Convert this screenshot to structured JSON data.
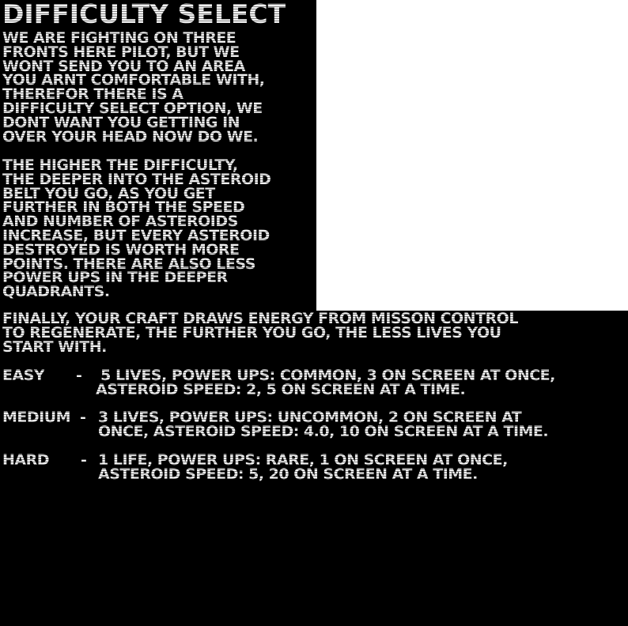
{
  "screen": {
    "title": "DIFFICULTY SELECT",
    "intro": "WE ARE FIGHTING ON THREE\nFRONTS HERE PILOT, BUT WE\nWONT SEND YOU TO AN AREA\nYOU ARNT COMFORTABLE WITH,\nTHEREFOR THERE IS A\nDIFFICULTY SELECT OPTION, WE\nDONT WANT YOU GETTING IN\nOVER YOUR HEAD NOW DO WE.",
    "explanation": "THE HIGHER THE DIFFICULTY,\nTHE DEEPER INTO THE ASTEROID\nBELT YOU GO, AS YOU GET\nFURTHER IN BOTH THE SPEED\nAND NUMBER OF ASTEROIDS\nINCREASE, BUT EVERY ASTEROID\nDESTROYED IS WORTH MORE\nPOINTS. THERE ARE ALSO LESS\nPOWER UPS IN THE DEEPER\nQUADRANTS.",
    "finally": "FINALLY, YOUR CRAFT DRAWS ENERGY FROM MISSON CONTROL\nTO REGENERATE, THE FURTHER YOU GO, THE LESS LIVES YOU\nSTART WITH."
  },
  "difficulties": [
    {
      "name": "EASY",
      "dash": "-",
      "description": " 5 LIVES, POWER UPS: COMMON, 3 ON SCREEN AT ONCE,\nASTEROID SPEED: 2, 5 ON SCREEN AT A TIME."
    },
    {
      "name": "MEDIUM",
      "dash": "-",
      "description": "3 LIVES, POWER UPS: UNCOMMON, 2 ON SCREEN AT\nONCE, ASTEROID SPEED: 4.0, 10 ON SCREEN AT A TIME."
    },
    {
      "name": "HARD",
      "dash": "-",
      "description": "1 LIFE, POWER UPS: RARE, 1 ON SCREEN AT ONCE,\nASTEROID SPEED: 5, 20 ON SCREEN AT A TIME."
    }
  ],
  "colors": {
    "background": "#000000",
    "panel": "#ffffff",
    "text": "#d6d6d6"
  }
}
